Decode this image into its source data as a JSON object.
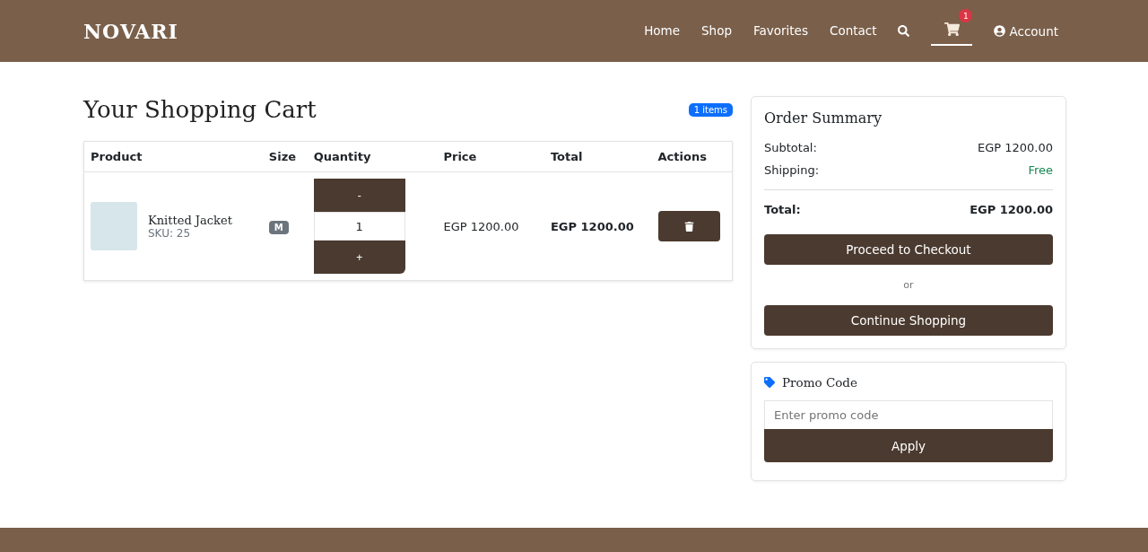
{
  "header": {
    "logo": "NOVARI",
    "nav": [
      {
        "label": "Home",
        "selected": false
      },
      {
        "label": "Shop",
        "selected": false
      },
      {
        "label": "Favorites",
        "selected": false
      },
      {
        "label": "Contact",
        "selected": false
      }
    ],
    "cart": {
      "count": "1",
      "selected": true
    },
    "account": "Account"
  },
  "cart": {
    "title": "Your Shopping Cart",
    "count_badge": "1 items",
    "columns": [
      "Product",
      "Size",
      "Quantity",
      "Price",
      "Total",
      "Actions"
    ],
    "rows": [
      {
        "name": "Knitted Jacket",
        "sku": "SKU: 25",
        "size": "M",
        "minus": "-",
        "quantity": "1",
        "plus": "+",
        "price": "EGP 1200.00",
        "total": "EGP 1200.00"
      }
    ]
  },
  "summary": {
    "title": "Order Summary",
    "lines": [
      {
        "label": "Subtotal:",
        "value": "EGP 1200.00",
        "kind": "plain"
      },
      {
        "label": "Shipping:",
        "value": "Free",
        "kind": "success"
      }
    ],
    "total_label": "Total:",
    "total_value": "EGP 1200.00",
    "checkout": "Proceed to Checkout",
    "or": "or",
    "continue": "Continue Shopping"
  },
  "promo": {
    "title": "Promo Code",
    "placeholder": "Enter promo code",
    "apply": "Apply"
  }
}
